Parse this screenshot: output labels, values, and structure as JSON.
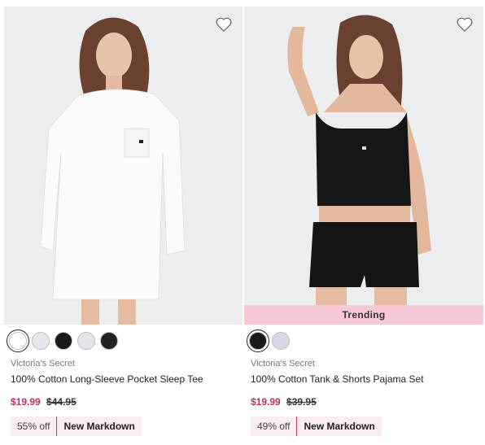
{
  "products": [
    {
      "brand": "Victoria's Secret",
      "title": "100% Cotton Long-Sleeve Pocket Sleep Tee",
      "sale_price": "$19.99",
      "original_price": "$44.95",
      "discount": "55% off",
      "markdown": "New Markdown",
      "tag": "",
      "swatches": [
        "#ffffff",
        "#e6e7ec",
        "#1a1a1a",
        "#e4e4ea",
        "#222222"
      ]
    },
    {
      "brand": "Victoria's Secret",
      "title": "100% Cotton Tank & Shorts Pajama Set",
      "sale_price": "$19.99",
      "original_price": "$39.95",
      "discount": "49% off",
      "markdown": "New Markdown",
      "tag": "Trending",
      "swatches": [
        "#1a1a1a",
        "#d8d9e2"
      ]
    }
  ],
  "colors": {
    "sale": "#b5326a",
    "tag_bg": "#f6c9d4",
    "badge_bg": "#fbeef1"
  }
}
